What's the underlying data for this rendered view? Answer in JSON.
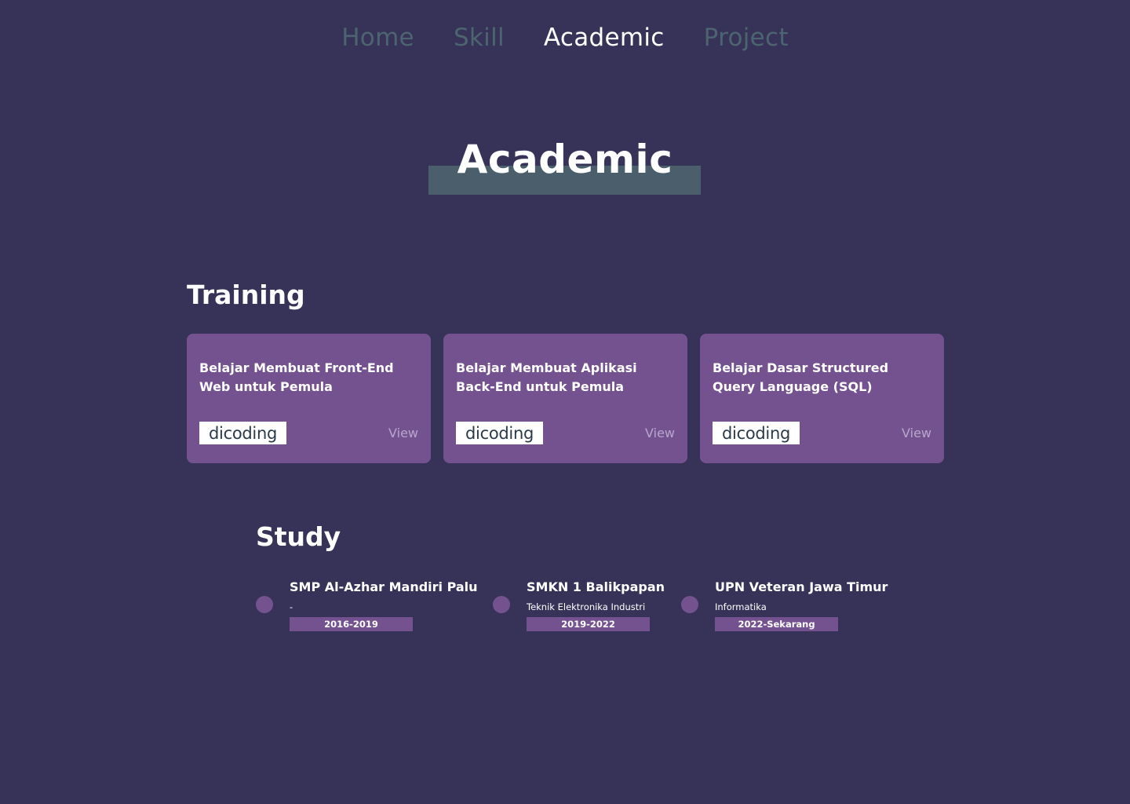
{
  "nav": {
    "items": [
      {
        "label": "Home",
        "active": false
      },
      {
        "label": "Skill",
        "active": false
      },
      {
        "label": "Academic",
        "active": true
      },
      {
        "label": "Project",
        "active": false
      }
    ]
  },
  "hero": {
    "title": "Academic"
  },
  "training": {
    "title": "Training",
    "cards": [
      {
        "title": "Belajar Membuat Front-End Web untuk Pemula",
        "logo": "dicoding",
        "action": "View"
      },
      {
        "title": "Belajar Membuat Aplikasi Back-End untuk Pemula",
        "logo": "dicoding",
        "action": "View"
      },
      {
        "title": "Belajar Dasar Structured Query Language (SQL)",
        "logo": "dicoding",
        "action": "View"
      }
    ]
  },
  "study": {
    "title": "Study",
    "items": [
      {
        "school": "SMP Al-Azhar Mandiri Palu",
        "major": "-",
        "years": "2016-2019"
      },
      {
        "school": "SMKN 1 Balikpapan",
        "major": "Teknik Elektronika Industri",
        "years": "2019-2022"
      },
      {
        "school": "UPN Veteran Jawa Timur",
        "major": "Informatika",
        "years": "2022-Sekarang"
      }
    ]
  },
  "colors": {
    "background": "#373358",
    "accent": "#74528f",
    "nav_inactive": "#4c6470",
    "title_bar": "#4a5f6b"
  }
}
